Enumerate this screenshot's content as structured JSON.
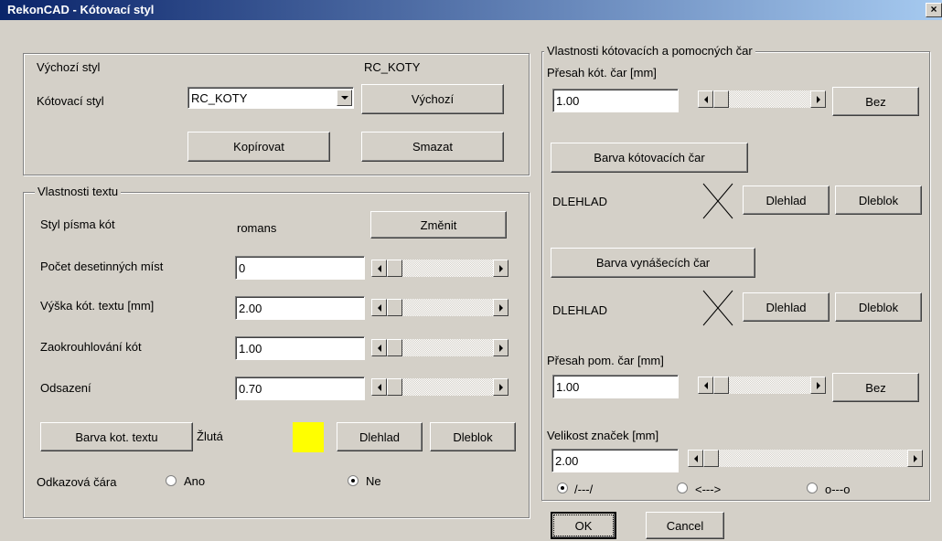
{
  "window": {
    "title": "RekonCAD - Kótovací styl",
    "close": "×"
  },
  "style_group": {
    "default_style_label": "Výchozí styl",
    "default_style_value": "RC_KOTY",
    "dim_style_label": "Kótovací styl",
    "dim_style_value": "RC_KOTY",
    "default_button": "Výchozí",
    "copy_button": "Kopírovat",
    "delete_button": "Smazat"
  },
  "text_group": {
    "title": "Vlastnosti textu",
    "font_label": "Styl písma kót",
    "font_value": "romans",
    "change_button": "Změnit",
    "decimals_label": "Počet desetinných míst",
    "decimals_value": "0",
    "height_label": "Výška kót. textu [mm]",
    "height_value": "2.00",
    "rounding_label": "Zaokrouhlování kót",
    "rounding_value": "1.00",
    "offset_label": "Odsazení",
    "offset_value": "0.70",
    "color_button": "Barva kot. textu",
    "color_name": "Žlutá",
    "color_hex": "#ffff00",
    "bylayer_button": "Dlehlad",
    "byblock_button": "Dleblok",
    "leader_label": "Odkazová čára",
    "leader_yes": "Ano",
    "leader_no": "Ne"
  },
  "lines_group": {
    "title": "Vlastnosti kótovacích a pomocných čar",
    "overshoot_label": "Přesah kót. čar [mm]",
    "overshoot_value": "1.00",
    "overshoot_none_button": "Bez",
    "dim_color_button": "Barva kótovacích čar",
    "dim_color_value": "DLEHLAD",
    "dim_bylayer_button": "Dlehlad",
    "dim_byblock_button": "Dleblok",
    "ext_color_button": "Barva vynášecích čar",
    "ext_color_value": "DLEHLAD",
    "ext_bylayer_button": "Dlehlad",
    "ext_byblock_button": "Dleblok",
    "ext_overshoot_label": "Přesah pom. čar [mm]",
    "ext_overshoot_value": "1.00",
    "ext_overshoot_none_button": "Bez",
    "marker_size_label": "Velikost značek [mm]",
    "marker_size_value": "2.00",
    "marker_option_1": "/---/",
    "marker_option_2": "<--->",
    "marker_option_3": "o---o"
  },
  "footer": {
    "ok_button": "OK",
    "cancel_button": "Cancel"
  }
}
